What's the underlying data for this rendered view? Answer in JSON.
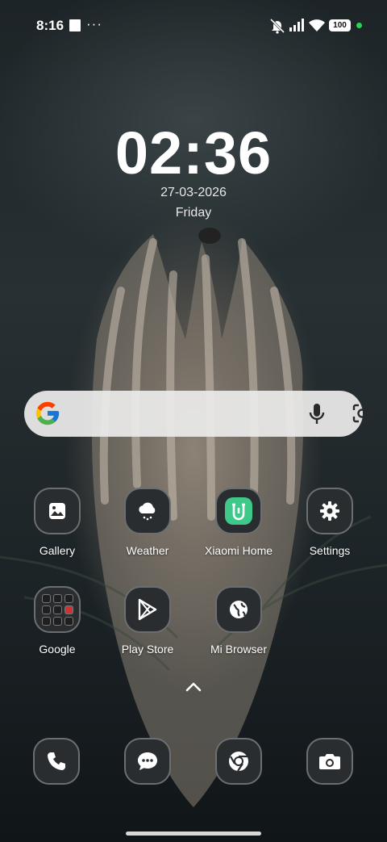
{
  "status_bar": {
    "time": "8:16",
    "overflow_indicator": "···",
    "battery_level": "100",
    "icons": [
      "notification-square-icon",
      "mute-icon",
      "signal-icon",
      "wifi-icon",
      "battery-icon",
      "privacy-dot-icon"
    ]
  },
  "clock_widget": {
    "time": "02:36",
    "date": "27-03-2026",
    "day": "Friday"
  },
  "search_bar": {
    "icons": [
      "google-logo-icon",
      "microphone-icon",
      "lens-icon"
    ]
  },
  "apps": [
    {
      "label": "Gallery",
      "icon": "gallery-icon"
    },
    {
      "label": "Weather",
      "icon": "weather-icon"
    },
    {
      "label": "Xiaomi Home",
      "icon": "xiaomi-home-icon",
      "accent": "#3ec98b"
    },
    {
      "label": "Settings",
      "icon": "gear-icon"
    },
    {
      "label": "Google",
      "icon": "google-folder-icon"
    },
    {
      "label": "Play Store",
      "icon": "play-store-icon"
    },
    {
      "label": "Mi Browser",
      "icon": "globe-icon"
    }
  ],
  "dock": [
    {
      "icon": "phone-icon"
    },
    {
      "icon": "messages-icon"
    },
    {
      "icon": "chrome-icon"
    },
    {
      "icon": "camera-icon"
    }
  ],
  "colors": {
    "icon_bg": "#2a2d2f",
    "icon_border": "#6b6f72",
    "search_bg": "#ebebe9",
    "status_dot": "#2ed158"
  }
}
